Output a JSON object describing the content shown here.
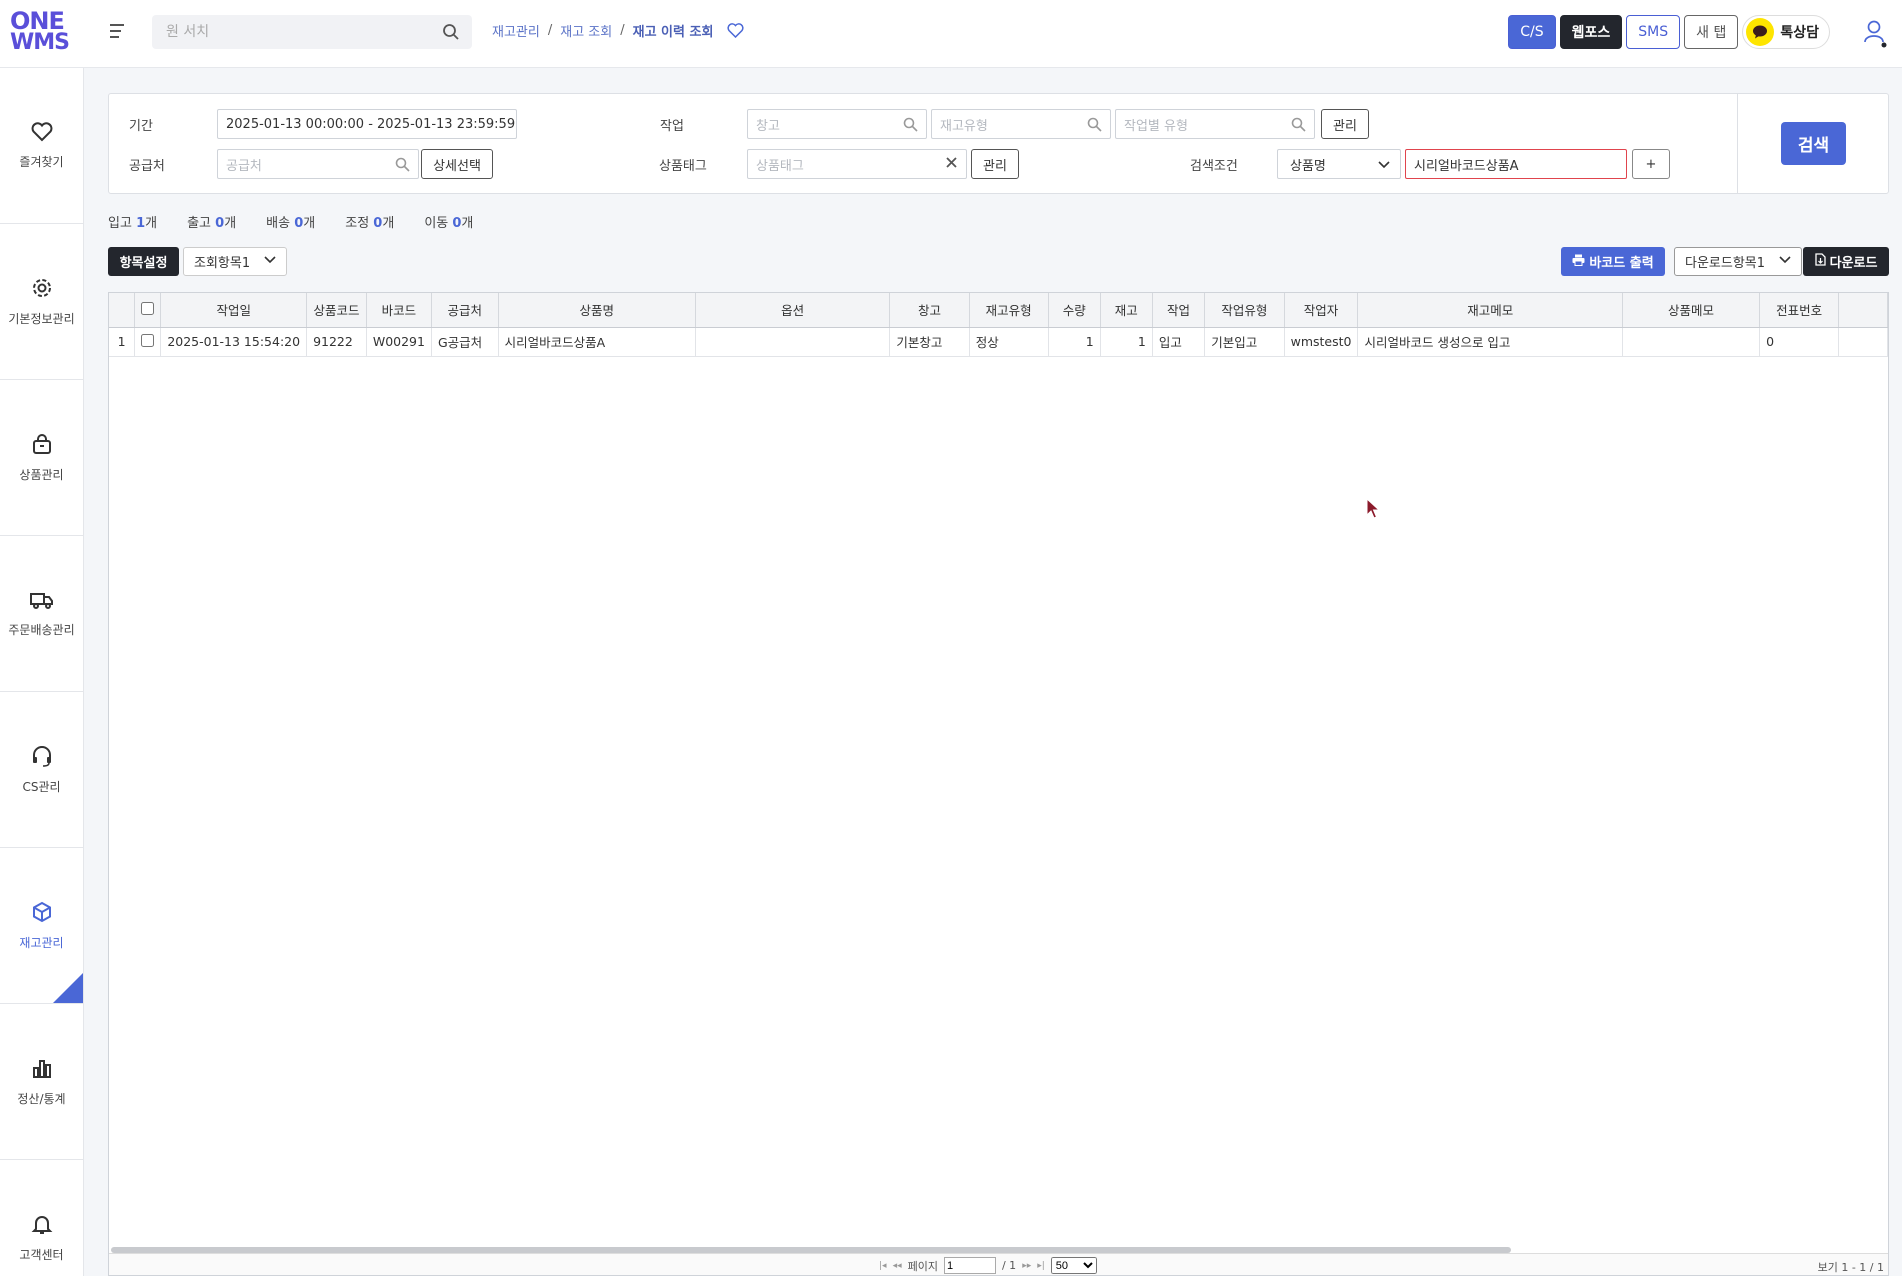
{
  "header": {
    "logo_line1": "ONE",
    "logo_line2": "WMS",
    "search_placeholder": "원 서치",
    "breadcrumb": [
      "재고관리",
      "재고 조회",
      "재고 이력 조회"
    ],
    "buttons": {
      "cs": "C/S",
      "webforce": "웹포스",
      "sms": "SMS",
      "new_tab": "새 탭",
      "talk": "톡상담"
    }
  },
  "sidebar": {
    "items": [
      {
        "label": "즐겨찾기",
        "icon": "heart-icon"
      },
      {
        "label": "기본정보관리",
        "icon": "gear-icon"
      },
      {
        "label": "상품관리",
        "icon": "bag-icon"
      },
      {
        "label": "주문배송관리",
        "icon": "truck-icon"
      },
      {
        "label": "CS관리",
        "icon": "headset-icon"
      },
      {
        "label": "재고관리",
        "icon": "box-icon",
        "active": true
      },
      {
        "label": "정산/통계",
        "icon": "bar-chart-icon"
      },
      {
        "label": "고객센터",
        "icon": "bell-icon"
      }
    ]
  },
  "filters": {
    "period_label": "기간",
    "period_value": "2025-01-13 00:00:00 - 2025-01-13 23:59:59",
    "supplier_label": "공급처",
    "supplier_placeholder": "공급처",
    "detail_select": "상세선택",
    "work_label": "작업",
    "warehouse_placeholder": "창고",
    "stock_type_placeholder": "재고유형",
    "work_type_placeholder": "작업별 유형",
    "manage": "관리",
    "tag_label": "상품태그",
    "tag_placeholder": "상품태그",
    "condition_label": "검색조건",
    "condition_select": "상품명",
    "condition_value": "시리얼바코드상품A",
    "plus": "+",
    "search_button": "검색"
  },
  "counts": [
    {
      "label": "입고",
      "value": "1",
      "unit": "개"
    },
    {
      "label": "출고",
      "value": "0",
      "unit": "개"
    },
    {
      "label": "배송",
      "value": "0",
      "unit": "개"
    },
    {
      "label": "조정",
      "value": "0",
      "unit": "개"
    },
    {
      "label": "이동",
      "value": "0",
      "unit": "개"
    }
  ],
  "toolbar": {
    "column_settings": "항목설정",
    "view_select": "조회항목1",
    "barcode_print": "바코드 출력",
    "download_select": "다운로드항목1",
    "download": "다운로드"
  },
  "grid": {
    "columns": [
      "작업일",
      "상품코드",
      "바코드",
      "공급처",
      "상품명",
      "옵션",
      "창고",
      "재고유형",
      "수량",
      "재고",
      "작업",
      "작업유형",
      "작업자",
      "재고메모",
      "상품메모",
      "전표번호"
    ],
    "rows": [
      {
        "no": "1",
        "date": "2025-01-13 15:54:20",
        "code": "91222",
        "barcode": "W00291",
        "supplier": "G공급처",
        "name": "시리얼바코드상품A",
        "option": "",
        "warehouse": "기본창고",
        "stock_type": "정상",
        "qty": "1",
        "stock": "1",
        "work": "입고",
        "work_type": "기본입고",
        "worker": "wmstest0",
        "stock_memo": "시리얼바코드 생성으로 입고",
        "product_memo": "",
        "slip": "0"
      }
    ]
  },
  "pager": {
    "page_label": "페이지",
    "page_value": "1",
    "page_total": "/ 1",
    "page_size": "50",
    "view_text": "보기 1 - 1 / 1"
  }
}
